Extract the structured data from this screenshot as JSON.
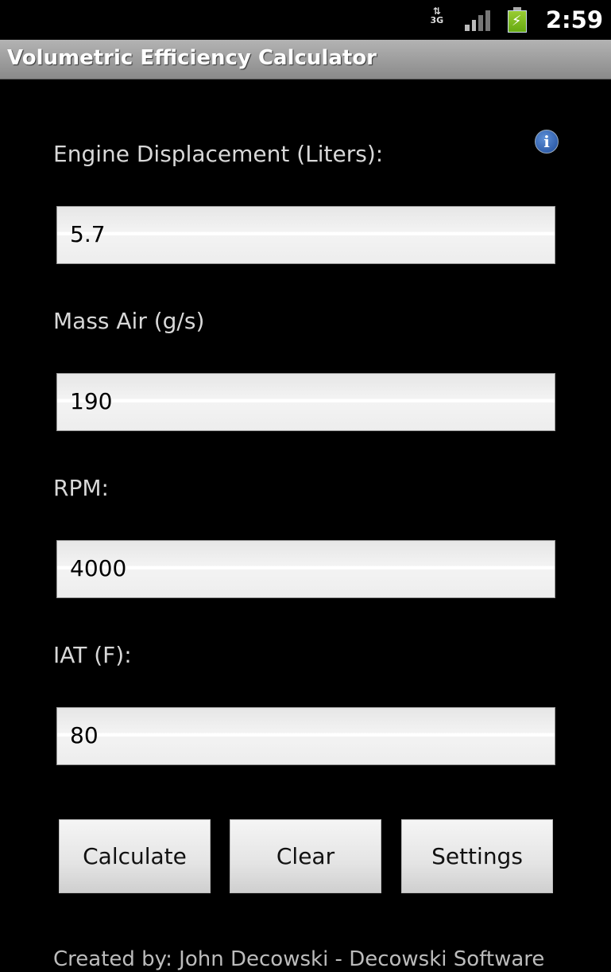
{
  "status_bar": {
    "network_type": "3G",
    "clock": "2:59",
    "icons": [
      "network-3g-icon",
      "signal-icon",
      "battery-charging-icon"
    ]
  },
  "app": {
    "title": "Volumetric Efficiency Calculator"
  },
  "fields": [
    {
      "label": "Engine Displacement (Liters):",
      "value": "5.7"
    },
    {
      "label": "Mass Air (g/s)",
      "value": "190"
    },
    {
      "label": "RPM:",
      "value": "4000"
    },
    {
      "label": "IAT (F):",
      "value": "80"
    }
  ],
  "buttons": {
    "calculate": "Calculate",
    "clear": "Clear",
    "settings": "Settings"
  },
  "footer": {
    "credit": "Created by: John Decowski - Decowski Software"
  },
  "colors": {
    "background": "#000000",
    "title_bar": "#9e9e9e",
    "label_text": "#d8d8d8",
    "info_icon": "#2a5aa8"
  }
}
